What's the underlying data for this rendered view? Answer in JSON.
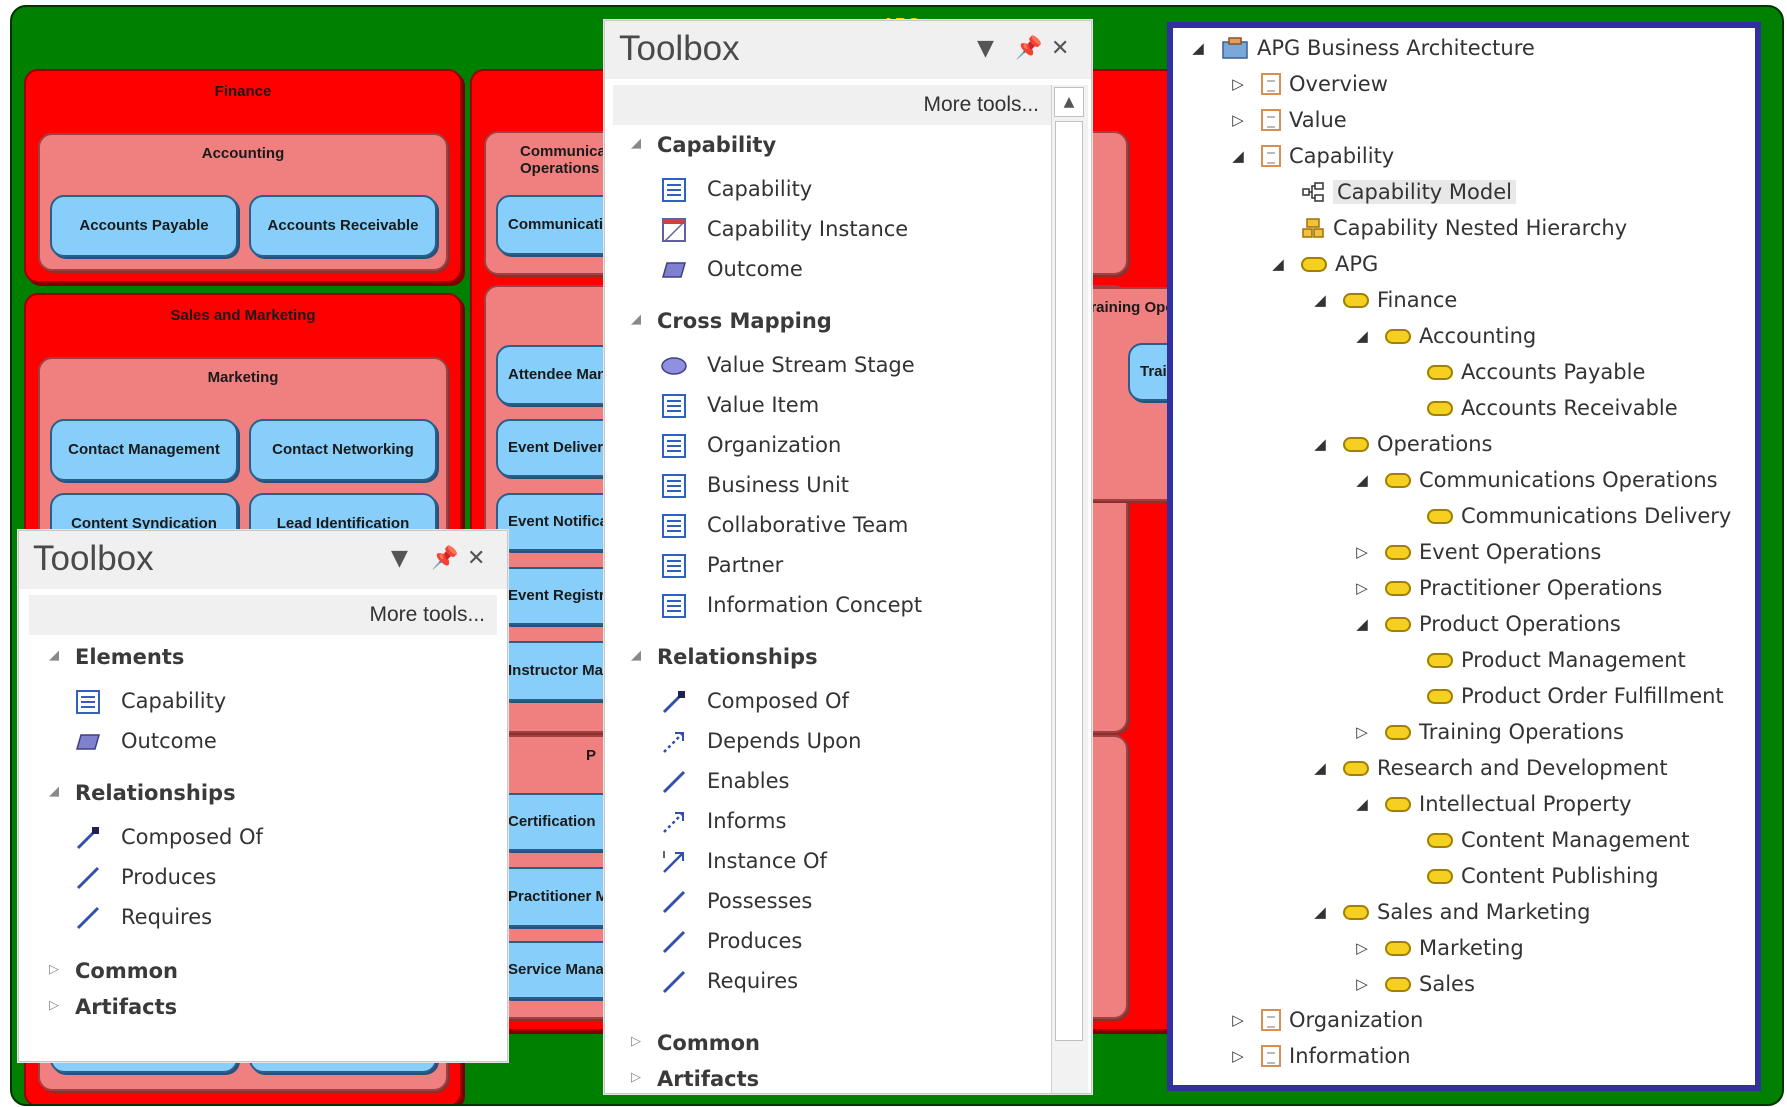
{
  "canvas": {
    "title": "APG",
    "groups": {
      "finance": {
        "title": "Finance",
        "accounting": {
          "title": "Accounting",
          "items": [
            "Accounts Payable",
            "Accounts Receivable"
          ]
        }
      },
      "sales": {
        "title": "Sales and Marketing",
        "marketing": {
          "title": "Marketing",
          "items": [
            "Contact Management",
            "Contact Networking",
            "Content Syndication",
            "Lead Identification"
          ]
        }
      },
      "operations": {
        "comm_title": "Communications Operations",
        "comm_item": "Communications Delivery",
        "event_items": [
          "Attendee Management",
          "Event Delivery",
          "Event Notification",
          "Event Registration",
          "Instructor Management"
        ],
        "practitioner_items": [
          "Certification",
          "Practitioner Management",
          "Service Management"
        ],
        "practitioner_title": "P",
        "right_title": "Training Operations",
        "right_item": "Training"
      }
    }
  },
  "toolbox_left": {
    "title": "Toolbox",
    "more_tools": "More tools...",
    "sections": {
      "elements": {
        "title": "Elements",
        "items": [
          "Capability",
          "Outcome"
        ]
      },
      "relationships": {
        "title": "Relationships",
        "items": [
          "Composed Of",
          "Produces",
          "Requires"
        ]
      },
      "common": "Common",
      "artifacts": "Artifacts"
    }
  },
  "toolbox_mid": {
    "title": "Toolbox",
    "more_tools": "More tools...",
    "sections": {
      "capability": {
        "title": "Capability",
        "items": [
          "Capability",
          "Capability Instance",
          "Outcome"
        ]
      },
      "cross_mapping": {
        "title": "Cross Mapping",
        "items": [
          "Value Stream Stage",
          "Value Item",
          "Organization",
          "Business Unit",
          "Collaborative Team",
          "Partner",
          "Information Concept"
        ]
      },
      "relationships": {
        "title": "Relationships",
        "items": [
          "Composed Of",
          "Depends Upon",
          "Enables",
          "Informs",
          "Instance Of",
          "Possesses",
          "Produces",
          "Requires"
        ]
      },
      "common": "Common",
      "artifacts": "Artifacts"
    }
  },
  "browser": {
    "root": "APG Business Architecture",
    "overview": "Overview",
    "value": "Value",
    "capability": "Capability",
    "capability_model": "Capability Model",
    "capability_nested": "Capability Nested Hierarchy",
    "apg": "APG",
    "finance": "Finance",
    "accounting": "Accounting",
    "accounts_payable": "Accounts Payable",
    "accounts_receivable": "Accounts Receivable",
    "operations": "Operations",
    "comm_ops": "Communications Operations",
    "comm_delivery": "Communications Delivery",
    "event_ops": "Event Operations",
    "practitioner_ops": "Practitioner Operations",
    "product_ops": "Product Operations",
    "product_mgmt": "Product Management",
    "product_order": "Product Order Fulfillment",
    "training_ops": "Training Operations",
    "rnd": "Research and Development",
    "ip": "Intellectual Property",
    "content_mgmt": "Content Management",
    "content_pub": "Content Publishing",
    "sales_marketing": "Sales and Marketing",
    "marketing": "Marketing",
    "sales": "Sales",
    "organization": "Organization",
    "information": "Information"
  },
  "colors": {
    "canvas": "#008000",
    "group": "#ff0000",
    "sub_group": "#f08080",
    "leaf": "#87cefa",
    "browser_border": "#3030a0",
    "capability_icon": "#f5d020"
  }
}
